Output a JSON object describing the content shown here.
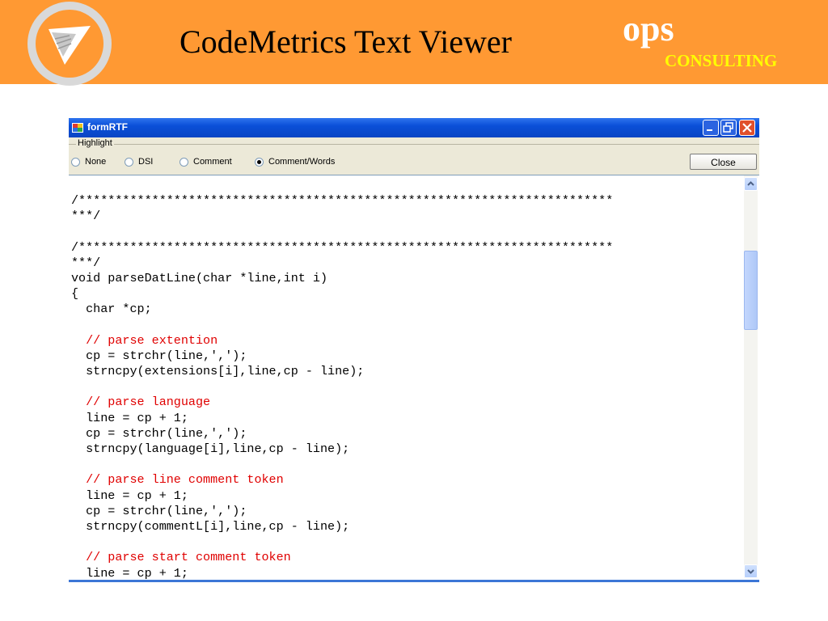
{
  "slide": {
    "title": "CodeMetrics Text Viewer",
    "brand_ops": "ops",
    "brand_consulting": "CONSULTING",
    "banner_color": "#ff9933",
    "logo_icon": "paper-plane-icon"
  },
  "window": {
    "title": "formRTF",
    "icon": "app-icon",
    "controls": [
      "minimize-icon",
      "restore-icon",
      "close-icon"
    ]
  },
  "toolbar": {
    "group_label": "Highlight",
    "options": [
      {
        "label": "None",
        "selected": false
      },
      {
        "label": "DSI",
        "selected": false
      },
      {
        "label": "Comment",
        "selected": false
      },
      {
        "label": "Comment/Words",
        "selected": true
      }
    ],
    "close_label": "Close"
  },
  "editor": {
    "comment_color": "#e00000",
    "lines": [
      {
        "text": "/*************************************************************************",
        "comment": false
      },
      {
        "text": "***/",
        "comment": false
      },
      {
        "text": "",
        "comment": false
      },
      {
        "text": "/*************************************************************************",
        "comment": false
      },
      {
        "text": "***/",
        "comment": false
      },
      {
        "text": "void parseDatLine(char *line,int i)",
        "comment": false
      },
      {
        "text": "{",
        "comment": false
      },
      {
        "text": "  char *cp;",
        "comment": false
      },
      {
        "text": "",
        "comment": false
      },
      {
        "text": "  // parse extention",
        "comment": true
      },
      {
        "text": "  cp = strchr(line,',');",
        "comment": false
      },
      {
        "text": "  strncpy(extensions[i],line,cp - line);",
        "comment": false
      },
      {
        "text": "",
        "comment": false
      },
      {
        "text": "  // parse language",
        "comment": true
      },
      {
        "text": "  line = cp + 1;",
        "comment": false
      },
      {
        "text": "  cp = strchr(line,',');",
        "comment": false
      },
      {
        "text": "  strncpy(language[i],line,cp - line);",
        "comment": false
      },
      {
        "text": "",
        "comment": false
      },
      {
        "text": "  // parse line comment token",
        "comment": true
      },
      {
        "text": "  line = cp + 1;",
        "comment": false
      },
      {
        "text": "  cp = strchr(line,',');",
        "comment": false
      },
      {
        "text": "  strncpy(commentL[i],line,cp - line);",
        "comment": false
      },
      {
        "text": "",
        "comment": false
      },
      {
        "text": "  // parse start comment token",
        "comment": true
      },
      {
        "text": "  line = cp + 1;",
        "comment": false
      }
    ]
  }
}
